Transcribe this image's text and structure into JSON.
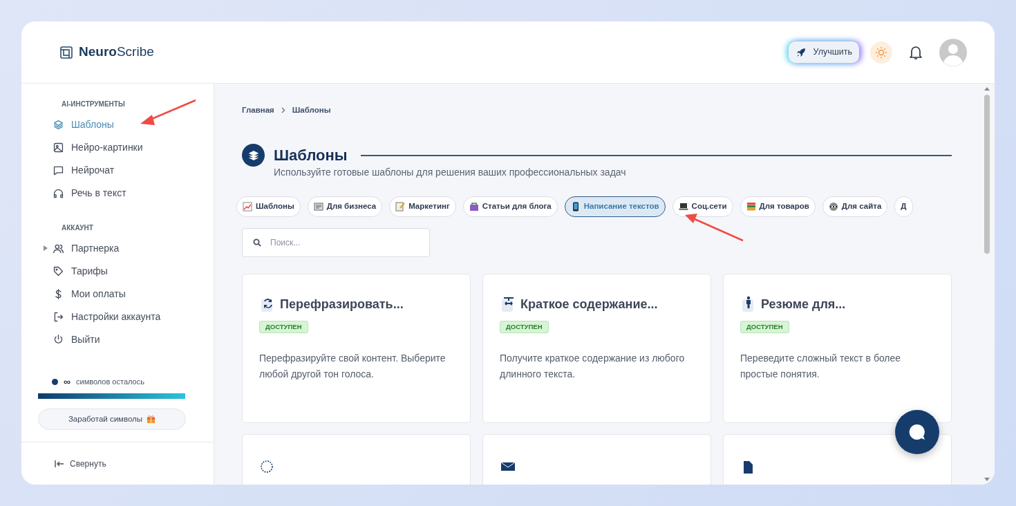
{
  "brand": {
    "bold": "Neuro",
    "light": "Scribe"
  },
  "header": {
    "upgrade_button": "Улучшить"
  },
  "sidebar": {
    "sections": [
      {
        "title": "AI-ИНСТРУМЕНТЫ",
        "items": [
          {
            "label": "Шаблоны",
            "selected": true,
            "expandable": false
          },
          {
            "label": "Нейро-картинки",
            "selected": false,
            "expandable": false
          },
          {
            "label": "Нейрочат",
            "selected": false,
            "expandable": false
          },
          {
            "label": "Речь в текст",
            "selected": false,
            "expandable": false
          }
        ]
      },
      {
        "title": "АККАУНТ",
        "items": [
          {
            "label": "Партнерка",
            "selected": false,
            "expandable": true
          },
          {
            "label": "Тарифы",
            "selected": false,
            "expandable": false
          },
          {
            "label": "Мои оплаты",
            "selected": false,
            "expandable": false
          },
          {
            "label": "Настройки аккаунта",
            "selected": false,
            "expandable": false
          },
          {
            "label": "Выйти",
            "selected": false,
            "expandable": false
          }
        ]
      }
    ],
    "credits": {
      "amount": "∞",
      "label": "символов осталось",
      "level": 1
    },
    "earn_button": "Заработай символы",
    "collapse": "Свернуть"
  },
  "breadcrumb": [
    {
      "label": "Главная"
    },
    {
      "label": "Шаблоны"
    }
  ],
  "page": {
    "title": "Шаблоны",
    "subtitle": "Используйте готовые шаблоны для решения ваших профессиональных задач"
  },
  "categories": [
    {
      "label": "Шаблоны",
      "selected": false
    },
    {
      "label": "Для бизнеса",
      "selected": false
    },
    {
      "label": "Маркетинг",
      "selected": false
    },
    {
      "label": "Статьи для блога",
      "selected": false
    },
    {
      "label": "Написание текстов",
      "selected": true
    },
    {
      "label": "Соц.сети",
      "selected": false
    },
    {
      "label": "Для товаров",
      "selected": false
    },
    {
      "label": "Для сайта",
      "selected": false
    },
    {
      "label": "Д",
      "selected": false
    }
  ],
  "search": {
    "placeholder": "Поиск..."
  },
  "templates": [
    {
      "kind": "full",
      "title": "Перефразировать...",
      "status": "ДОСТУПЕН",
      "description": "Перефразируйте свой контент. Выберите любой другой тон голоса."
    },
    {
      "kind": "full",
      "title": "Краткое содержание...",
      "status": "ДОСТУПЕН",
      "description": "Получите краткое содержание из любого длинного текста."
    },
    {
      "kind": "full",
      "title": "Резюме для...",
      "status": "ДОСТУПЕН",
      "description": "Переведите сложный текст в более простые понятия."
    },
    {
      "kind": "cut"
    },
    {
      "kind": "cut"
    },
    {
      "kind": "cut"
    }
  ]
}
